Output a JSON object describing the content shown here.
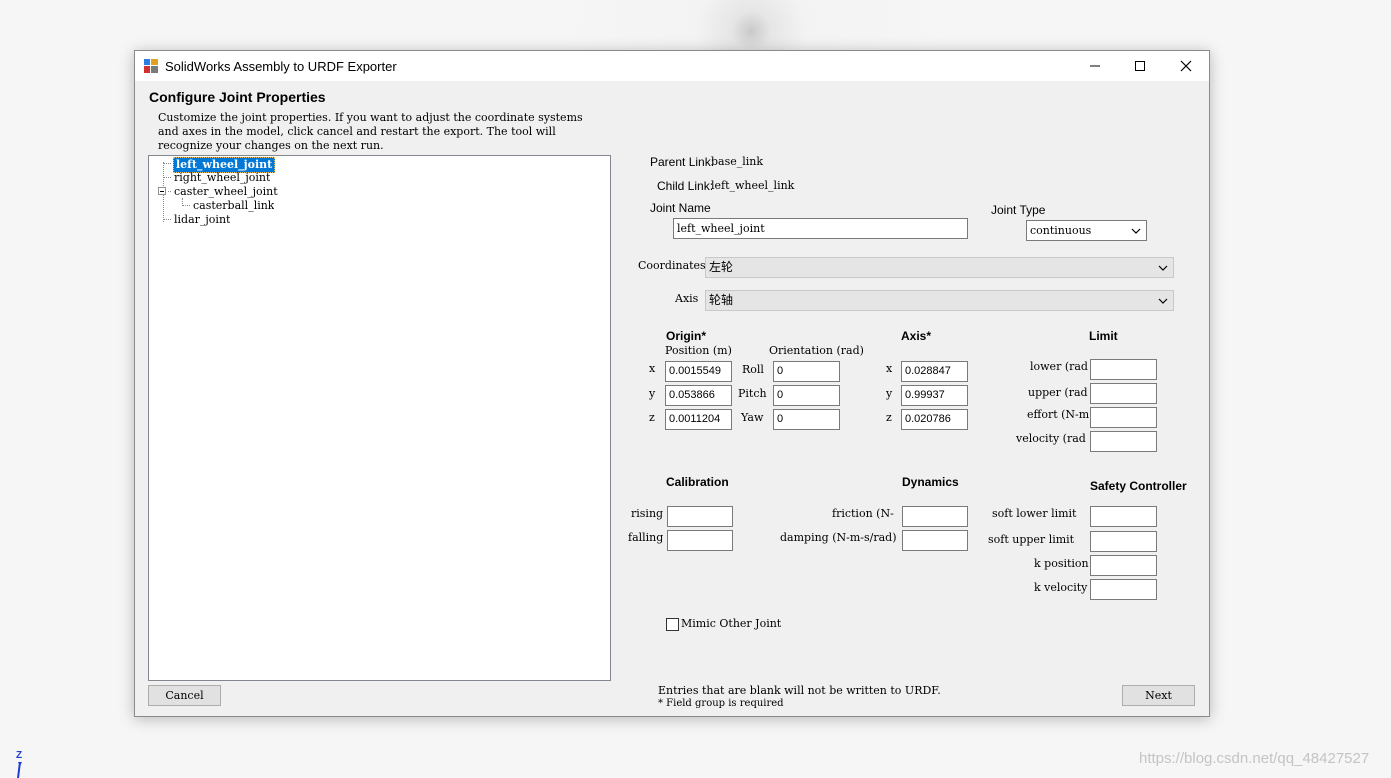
{
  "window": {
    "title": "SolidWorks Assembly to URDF Exporter"
  },
  "page": {
    "heading": "Configure Joint Properties",
    "instructions": "Customize the joint properties. If you want to adjust the coordinate systems and axes in the model, click cancel and restart the export. The tool will recognize your changes on the next run."
  },
  "tree": {
    "items": [
      {
        "label": "left_wheel_joint",
        "selected": true
      },
      {
        "label": "right_wheel_joint"
      },
      {
        "label": "caster_wheel_joint",
        "expanded": true
      },
      {
        "label": "casterball_link",
        "child": true
      },
      {
        "label": "lidar_joint"
      }
    ]
  },
  "links": {
    "parent_label": "Parent Link:",
    "parent_value": "base_link",
    "child_label": "Child Link:",
    "child_value": "left_wheel_link"
  },
  "joint": {
    "name_label": "Joint Name",
    "name_value": "left_wheel_joint",
    "type_label": "Joint Type",
    "type_value": "continuous"
  },
  "coordinates": {
    "label": "Coordinates",
    "value": "左轮"
  },
  "axis_select": {
    "label": "Axis",
    "value": "轮轴"
  },
  "origin": {
    "heading": "Origin*",
    "position_label": "Position (m)",
    "orientation_label": "Orientation (rad)",
    "x_label": "x",
    "x_value": "0.0015549",
    "y_label": "y",
    "y_value": "0.053866",
    "z_label": "z",
    "z_value": "0.0011204",
    "roll_label": "Roll",
    "roll_value": "0",
    "pitch_label": "Pitch",
    "pitch_value": "0",
    "yaw_label": "Yaw",
    "yaw_value": "0"
  },
  "axis": {
    "heading": "Axis*",
    "x_label": "x",
    "x_value": "0.028847",
    "y_label": "y",
    "y_value": "0.99937",
    "z_label": "z",
    "z_value": "0.020786"
  },
  "limit": {
    "heading": "Limit",
    "lower_label": "lower (rad",
    "upper_label": "upper (rad",
    "effort_label": "effort (N-m",
    "velocity_label": "velocity (rad"
  },
  "calibration": {
    "heading": "Calibration",
    "rising_label": "rising",
    "falling_label": "falling"
  },
  "dynamics": {
    "heading": "Dynamics",
    "friction_label": "friction (N-",
    "damping_label": "damping (N-m-s/rad)"
  },
  "safety": {
    "heading": "Safety Controller",
    "soft_lower_label": "soft lower limit",
    "soft_upper_label": "soft upper limit",
    "k_position_label": "k position",
    "k_velocity_label": "k velocity"
  },
  "mimic": {
    "label": "Mimic Other Joint",
    "checked": false
  },
  "footer": {
    "note1": "Entries that are blank will not be written to URDF.",
    "note2": "* Field group is required",
    "cancel_label": "Cancel",
    "next_label": "Next"
  },
  "desktop": {
    "watermark": "https://blog.csdn.net/qq_48427527",
    "axis_indicator": "Z"
  }
}
